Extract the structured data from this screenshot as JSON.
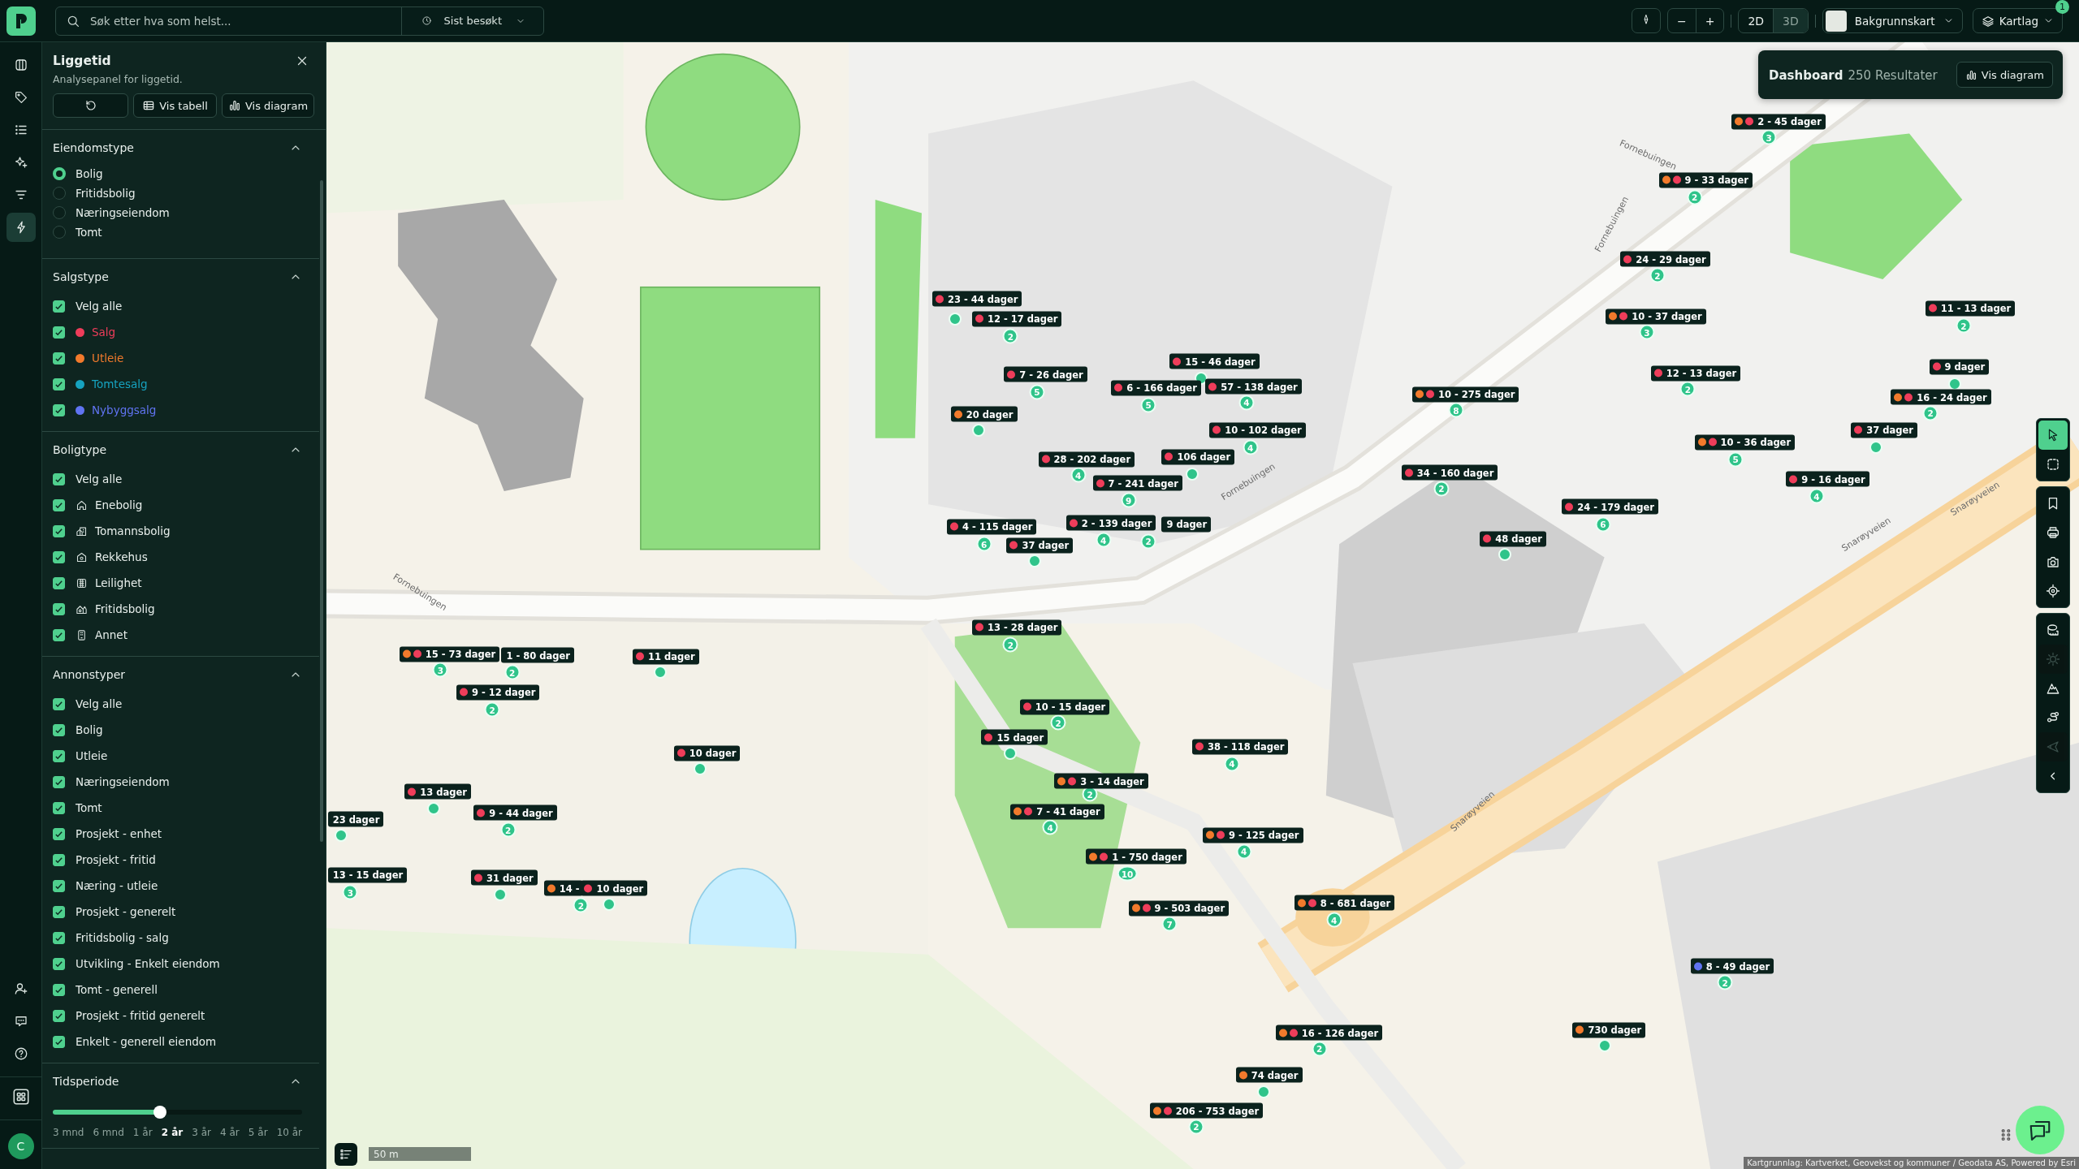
{
  "topbar": {
    "search": {
      "placeholder": "Søk etter hva som helst..."
    },
    "recent": "Sist besøkt",
    "zoom_out": "−",
    "zoom_in": "+",
    "view_modes": [
      {
        "label": "2D",
        "selected": false
      },
      {
        "label": "3D",
        "selected": true
      }
    ],
    "basemap": "Bakgrunnskart",
    "layers": "Kartlag",
    "layers_badge": "1"
  },
  "rail": {
    "items": [
      {
        "kind": "map",
        "selected": false
      },
      {
        "kind": "tag",
        "selected": false
      },
      {
        "kind": "list",
        "selected": false
      },
      {
        "kind": "sparkle",
        "selected": false
      },
      {
        "kind": "filter",
        "selected": false
      },
      {
        "kind": "bolt",
        "selected": true
      }
    ],
    "bottom_items": [
      {
        "kind": "user-add"
      },
      {
        "kind": "chat"
      },
      {
        "kind": "help"
      },
      {
        "kind": "apps"
      }
    ],
    "avatar": "C"
  },
  "panel": {
    "title": "Liggetid",
    "subtitle": "Analysepanel for liggetid.",
    "buttons": [
      {
        "kind": "reset"
      },
      {
        "kind": "table",
        "label": "Vis tabell"
      },
      {
        "kind": "chart",
        "label": "Vis diagram"
      }
    ],
    "sections": [
      {
        "kind": "radio",
        "title": "Eiendomstype",
        "expanded": true,
        "options": [
          {
            "label": "Bolig",
            "selected": true
          },
          {
            "label": "Fritidsbolig",
            "selected": false
          },
          {
            "label": "Næringseiendom",
            "selected": false
          },
          {
            "label": "Tomt",
            "selected": false
          }
        ]
      },
      {
        "kind": "checkbox",
        "title": "Salgstype",
        "expanded": true,
        "options": [
          {
            "label": "Velg alle",
            "checked": true
          },
          {
            "label": "Salg",
            "checked": true,
            "color": "#ee3d5a"
          },
          {
            "label": "Utleie",
            "checked": true,
            "color": "#f27a2c"
          },
          {
            "label": "Tomtesalg",
            "checked": true,
            "color": "#16a3c0"
          },
          {
            "label": "Nybyggsalg",
            "checked": true,
            "color": "#6074f2"
          }
        ]
      },
      {
        "kind": "checkbox",
        "title": "Boligtype",
        "expanded": true,
        "options": [
          {
            "label": "Velg alle",
            "checked": true
          },
          {
            "label": "Enebolig",
            "checked": true,
            "kind": "house"
          },
          {
            "label": "Tomannsbolig",
            "checked": true,
            "kind": "duplex"
          },
          {
            "label": "Rekkehus",
            "checked": true,
            "kind": "rowhouse"
          },
          {
            "label": "Leilighet",
            "checked": true,
            "kind": "apartment"
          },
          {
            "label": "Fritidsbolig",
            "checked": true,
            "kind": "cabin"
          },
          {
            "label": "Annet",
            "checked": true,
            "kind": "other"
          }
        ]
      },
      {
        "kind": "checkbox",
        "title": "Annonstyper",
        "expanded": true,
        "options": [
          {
            "label": "Velg alle",
            "checked": true
          },
          {
            "label": "Bolig",
            "checked": true
          },
          {
            "label": "Utleie",
            "checked": true
          },
          {
            "label": "Næringseiendom",
            "checked": true
          },
          {
            "label": "Tomt",
            "checked": true
          },
          {
            "label": "Prosjekt - enhet",
            "checked": true
          },
          {
            "label": "Prosjekt - fritid",
            "checked": true
          },
          {
            "label": "Næring - utleie",
            "checked": true
          },
          {
            "label": "Prosjekt - generelt",
            "checked": true
          },
          {
            "label": "Fritidsbolig - salg",
            "checked": true
          },
          {
            "label": "Utvikling - Enkelt eiendom",
            "checked": true
          },
          {
            "label": "Tomt - generell",
            "checked": true
          },
          {
            "label": "Prosjekt - fritid generelt",
            "checked": true
          },
          {
            "label": "Enkelt - generell eiendom",
            "checked": true
          }
        ]
      },
      {
        "kind": "slider",
        "title": "Tidsperiode",
        "expanded": true,
        "level": 0.43,
        "ticks": [
          {
            "label": "3 mnd",
            "selected": false
          },
          {
            "label": "6 mnd",
            "selected": false
          },
          {
            "label": "1 år",
            "selected": false
          },
          {
            "label": "2 år",
            "selected": true
          },
          {
            "label": "3 år",
            "selected": false
          },
          {
            "label": "4 år",
            "selected": false
          },
          {
            "label": "5 år",
            "selected": false
          },
          {
            "label": "10 år",
            "selected": false
          }
        ]
      }
    ]
  },
  "dashboard": {
    "title": "Dashboard",
    "count": "250 Resultater",
    "button": "Vis diagram"
  },
  "tool_groups": [
    {
      "tools": [
        {
          "kind": "pointer",
          "selected": true,
          "disabled": false
        },
        {
          "kind": "select-area",
          "selected": false,
          "disabled": false
        }
      ]
    },
    {
      "tools": [
        {
          "kind": "bookmark",
          "selected": false,
          "disabled": false
        },
        {
          "kind": "print",
          "selected": false,
          "disabled": false
        },
        {
          "kind": "camera",
          "selected": false,
          "disabled": false
        },
        {
          "kind": "locate",
          "selected": false,
          "disabled": false
        }
      ]
    },
    {
      "tools": [
        {
          "kind": "measure",
          "selected": false,
          "disabled": false
        },
        {
          "kind": "sun",
          "selected": false,
          "disabled": true
        },
        {
          "kind": "terrain",
          "selected": false,
          "disabled": false
        },
        {
          "kind": "route",
          "selected": false,
          "disabled": false
        },
        {
          "kind": "view",
          "selected": false,
          "disabled": true
        },
        {
          "kind": "collapse",
          "selected": false,
          "disabled": false
        }
      ]
    }
  ],
  "map": {
    "street_labels": [
      "Fornebuingen",
      "Fornebuingen",
      "Fornebuingen",
      "Fornebuingen",
      "Snarøyveien",
      "Snarøyveien",
      "Snarøyveien"
    ],
    "markers": [
      {
        "label": "2 - 45 dager",
        "dots": [
          {
            "color": "#f27a2c"
          },
          {
            "color": "#ee3d5a"
          }
        ],
        "count": "3"
      },
      {
        "label": "9 - 33 dager",
        "dots": [
          {
            "color": "#f27a2c"
          },
          {
            "color": "#ee3d5a"
          }
        ],
        "count": "2"
      },
      {
        "label": "24 - 29 dager",
        "dots": [
          {
            "color": "#ee3d5a"
          }
        ],
        "count": "2"
      },
      {
        "label": "10 - 37 dager",
        "dots": [
          {
            "color": "#f27a2c"
          },
          {
            "color": "#ee3d5a"
          }
        ],
        "count": "3"
      },
      {
        "label": "12 - 13 dager",
        "dots": [
          {
            "color": "#ee3d5a"
          }
        ],
        "count": "2"
      },
      {
        "label": "11 - 13 dager",
        "dots": [
          {
            "color": "#ee3d5a"
          }
        ],
        "count": "2"
      },
      {
        "label": "9 dager",
        "dots": [
          {
            "color": "#ee3d5a"
          }
        ]
      },
      {
        "label": "16 - 24 dager",
        "dots": [
          {
            "color": "#f27a2c"
          },
          {
            "color": "#ee3d5a"
          }
        ],
        "count": "2"
      },
      {
        "label": "37 dager",
        "dots": [
          {
            "color": "#ee3d5a"
          }
        ]
      },
      {
        "label": "10 - 36 dager",
        "dots": [
          {
            "color": "#f27a2c"
          },
          {
            "color": "#ee3d5a"
          }
        ],
        "count": "5"
      },
      {
        "label": "9 - 16 dager",
        "dots": [
          {
            "color": "#ee3d5a"
          }
        ],
        "count": "4"
      },
      {
        "label": "10 - 275 dager",
        "dots": [
          {
            "color": "#f27a2c"
          },
          {
            "color": "#ee3d5a"
          }
        ],
        "count": "8"
      },
      {
        "label": "34 - 160 dager",
        "dots": [
          {
            "color": "#ee3d5a"
          }
        ],
        "count": "2"
      },
      {
        "label": "24 - 179 dager",
        "dots": [
          {
            "color": "#ee3d5a"
          }
        ],
        "count": "6"
      },
      {
        "label": "48 dager",
        "dots": [
          {
            "color": "#ee3d5a"
          }
        ]
      },
      {
        "label": "23 - 44 dager",
        "dots": [
          {
            "color": "#ee3d5a"
          }
        ]
      },
      {
        "label": "12 - 17 dager",
        "dots": [
          {
            "color": "#ee3d5a"
          }
        ],
        "count": "2"
      },
      {
        "label": "15 - 46 dager",
        "dots": [
          {
            "color": "#ee3d5a"
          }
        ]
      },
      {
        "label": "6 - 166 dager",
        "dots": [
          {
            "color": "#ee3d5a"
          }
        ],
        "count": "5"
      },
      {
        "label": "57 - 138 dager",
        "dots": [
          {
            "color": "#ee3d5a"
          }
        ],
        "count": "4"
      },
      {
        "label": "7 - 26 dager",
        "dots": [
          {
            "color": "#ee3d5a"
          }
        ],
        "count": "5"
      },
      {
        "label": "20 dager",
        "dots": [
          {
            "color": "#f27a2c"
          }
        ]
      },
      {
        "label": "10 - 102 dager",
        "dots": [
          {
            "color": "#ee3d5a"
          }
        ],
        "count": "4"
      },
      {
        "label": "28 - 202 dager",
        "dots": [
          {
            "color": "#ee3d5a"
          }
        ],
        "count": "4"
      },
      {
        "label": "106 dager",
        "dots": [
          {
            "color": "#ee3d5a"
          }
        ]
      },
      {
        "label": "7 - 241 dager",
        "dots": [
          {
            "color": "#ee3d5a"
          }
        ],
        "count": "9"
      },
      {
        "label": "4 - 115 dager",
        "dots": [
          {
            "color": "#ee3d5a"
          }
        ],
        "count": "6"
      },
      {
        "label": "2 - 139 dager",
        "dots": [
          {
            "color": "#ee3d5a"
          }
        ],
        "count": "4"
      },
      {
        "label": "9 dager",
        "count": "2"
      },
      {
        "label": "37 dager",
        "dots": [
          {
            "color": "#ee3d5a"
          }
        ]
      },
      {
        "label": "13 - 28 dager",
        "dots": [
          {
            "color": "#ee3d5a"
          }
        ],
        "count": "2"
      },
      {
        "label": "15 - 73 dager",
        "dots": [
          {
            "color": "#f27a2c"
          },
          {
            "color": "#ee3d5a"
          }
        ],
        "count": "3"
      },
      {
        "label": "1 - 80 dager",
        "count": "2"
      },
      {
        "label": "11 dager",
        "dots": [
          {
            "color": "#ee3d5a"
          }
        ]
      },
      {
        "label": "9 - 12 dager",
        "dots": [
          {
            "color": "#ee3d5a"
          }
        ],
        "count": "2"
      },
      {
        "label": "10 - 15 dager",
        "dots": [
          {
            "color": "#ee3d5a"
          }
        ],
        "count": "2"
      },
      {
        "label": "15 dager",
        "dots": [
          {
            "color": "#ee3d5a"
          }
        ]
      },
      {
        "label": "10 dager",
        "dots": [
          {
            "color": "#ee3d5a"
          }
        ]
      },
      {
        "label": "38 - 118 dager",
        "dots": [
          {
            "color": "#ee3d5a"
          }
        ],
        "count": "4"
      },
      {
        "label": "3 - 14 dager",
        "dots": [
          {
            "color": "#f27a2c"
          },
          {
            "color": "#ee3d5a"
          }
        ],
        "count": "2"
      },
      {
        "label": "7 - 41 dager",
        "dots": [
          {
            "color": "#f27a2c"
          },
          {
            "color": "#ee3d5a"
          }
        ],
        "count": "4"
      },
      {
        "label": "13 dager",
        "dots": [
          {
            "color": "#ee3d5a"
          }
        ]
      },
      {
        "label": "23 dager"
      },
      {
        "label": "9 - 44 dager",
        "dots": [
          {
            "color": "#ee3d5a"
          }
        ],
        "count": "2"
      },
      {
        "label": "9 - 125 dager",
        "dots": [
          {
            "color": "#f27a2c"
          },
          {
            "color": "#ee3d5a"
          }
        ],
        "count": "4"
      },
      {
        "label": "1 - 750 dager",
        "dots": [
          {
            "color": "#f27a2c"
          },
          {
            "color": "#ee3d5a"
          }
        ],
        "count": "10"
      },
      {
        "label": "13 - 15 dager",
        "count": "3"
      },
      {
        "label": "31 dager",
        "dots": [
          {
            "color": "#ee3d5a"
          }
        ]
      },
      {
        "label": "14 -",
        "dots": [
          {
            "color": "#f27a2c"
          }
        ],
        "count": "2"
      },
      {
        "label": "10 dager",
        "dots": [
          {
            "color": "#ee3d5a"
          }
        ]
      },
      {
        "label": "9 - 503 dager",
        "dots": [
          {
            "color": "#f27a2c"
          },
          {
            "color": "#ee3d5a"
          }
        ],
        "count": "7"
      },
      {
        "label": "8 - 681 dager",
        "dots": [
          {
            "color": "#f27a2c"
          },
          {
            "color": "#ee3d5a"
          }
        ],
        "count": "4"
      },
      {
        "label": "8 - 49 dager",
        "dots": [
          {
            "color": "#6074f2"
          }
        ],
        "count": "2"
      },
      {
        "label": "16 - 126 dager",
        "dots": [
          {
            "color": "#f27a2c"
          },
          {
            "color": "#ee3d5a"
          }
        ],
        "count": "2"
      },
      {
        "label": "730 dager",
        "dots": [
          {
            "color": "#f27a2c"
          }
        ]
      },
      {
        "label": "74 dager",
        "dots": [
          {
            "color": "#f27a2c"
          }
        ]
      },
      {
        "label": "206 - 753 dager",
        "dots": [
          {
            "color": "#f27a2c"
          },
          {
            "color": "#ee3d5a"
          }
        ],
        "count": "2"
      }
    ],
    "scale": "50 m",
    "attribution": "Kartgrunnlag: Kartverket, Geovekst og kommuner / Geodata AS, Powered by Esri"
  }
}
